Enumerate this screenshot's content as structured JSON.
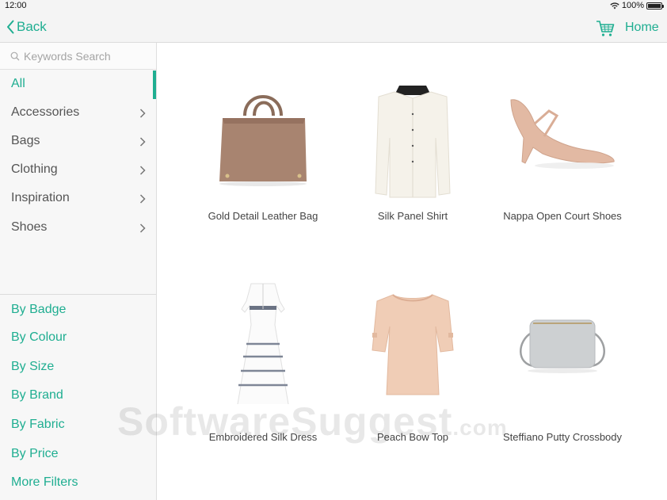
{
  "status": {
    "time": "12:00",
    "battery": "100%"
  },
  "nav": {
    "back_label": "Back",
    "home_label": "Home"
  },
  "search": {
    "placeholder": "Keywords Search"
  },
  "categories": [
    {
      "label": "All",
      "active": true
    },
    {
      "label": "Accessories"
    },
    {
      "label": "Bags"
    },
    {
      "label": "Clothing"
    },
    {
      "label": "Inspiration"
    },
    {
      "label": "Shoes"
    }
  ],
  "filters": [
    "By Badge",
    "By Colour",
    "By Size",
    "By Brand",
    "By Fabric",
    "By Price",
    "More Filters"
  ],
  "products": [
    {
      "name": "Gold Detail Leather Bag"
    },
    {
      "name": "Silk Panel Shirt"
    },
    {
      "name": "Nappa Open Court Shoes"
    },
    {
      "name": "Embroidered Silk Dress"
    },
    {
      "name": "Peach Bow Top"
    },
    {
      "name": "Steffiano Putty Crossbody"
    }
  ],
  "watermark": {
    "text": "SoftwareSuggest",
    "suffix": ".com"
  },
  "colors": {
    "accent": "#1fae91"
  }
}
